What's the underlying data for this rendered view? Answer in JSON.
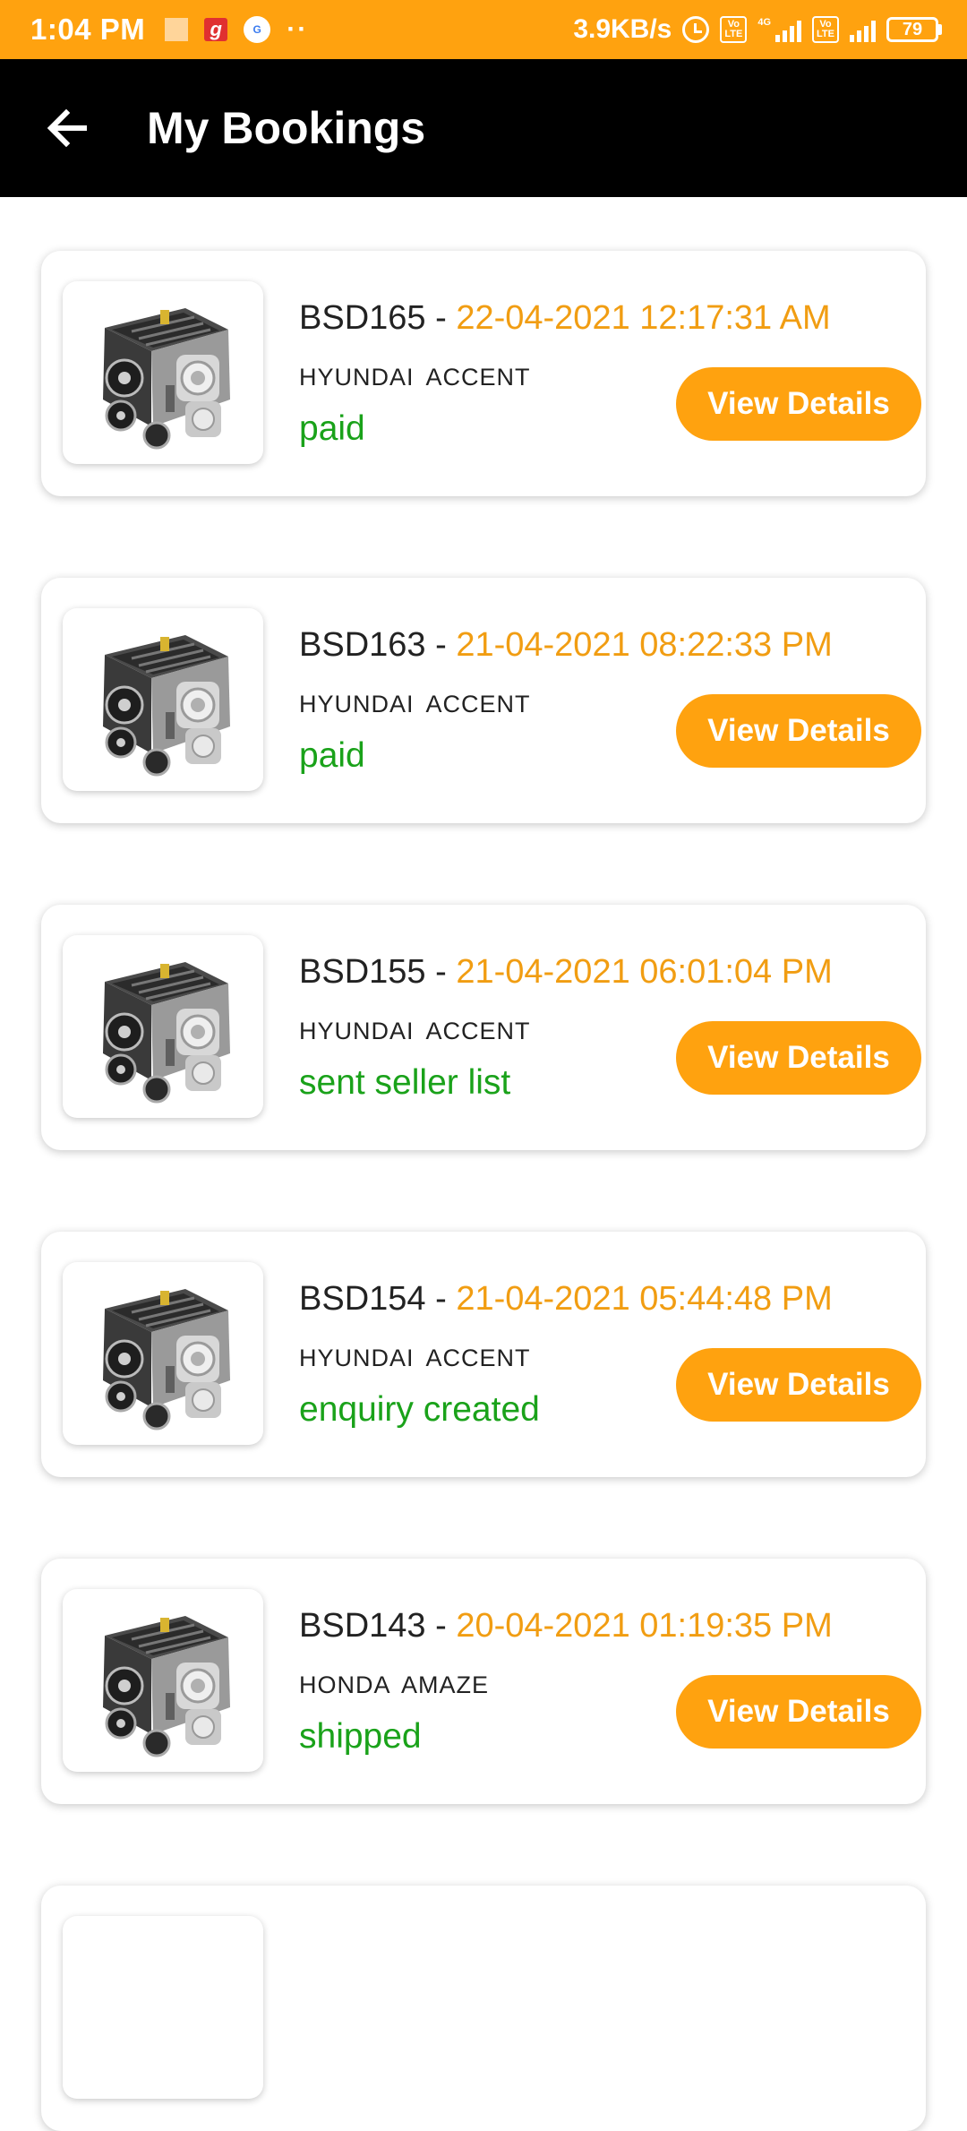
{
  "status_bar": {
    "time": "1:04 PM",
    "net_speed": "3.9KB/s",
    "network_label": "4G",
    "volte_label": "Vo LTE",
    "battery": "79",
    "notification_icons": [
      "gallery-icon",
      "g-app-icon",
      "gpay-icon",
      "more-dots-icon"
    ]
  },
  "app_bar": {
    "title": "My Bookings",
    "back_icon": "arrow-left-icon"
  },
  "theme": {
    "accent": "#ffa20f",
    "date_color": "#f19d12",
    "status_color": "#1aa21a",
    "app_bar_bg": "#000000"
  },
  "bookings": [
    {
      "id": "BSD165",
      "separator": " - ",
      "date": "22-04-2021 12:17:31 AM",
      "vehicle": "HYUNDAI ACCENT",
      "status": "paid",
      "button_label": "View Details",
      "image_icon": "engine-icon"
    },
    {
      "id": "BSD163",
      "separator": " - ",
      "date": "21-04-2021 08:22:33 PM",
      "vehicle": "HYUNDAI ACCENT",
      "status": "paid",
      "button_label": "View Details",
      "image_icon": "engine-icon"
    },
    {
      "id": "BSD155",
      "separator": " - ",
      "date": "21-04-2021 06:01:04 PM",
      "vehicle": "HYUNDAI ACCENT",
      "status": "sent seller list",
      "button_label": "View Details",
      "image_icon": "engine-icon"
    },
    {
      "id": "BSD154",
      "separator": " - ",
      "date": "21-04-2021 05:44:48 PM",
      "vehicle": "HYUNDAI ACCENT",
      "status": "enquiry created",
      "button_label": "View Details",
      "image_icon": "engine-icon"
    },
    {
      "id": "BSD143",
      "separator": " - ",
      "date": "20-04-2021 01:19:35 PM",
      "vehicle": "HONDA AMAZE",
      "status": "shipped",
      "button_label": "View Details",
      "image_icon": "engine-icon"
    }
  ]
}
